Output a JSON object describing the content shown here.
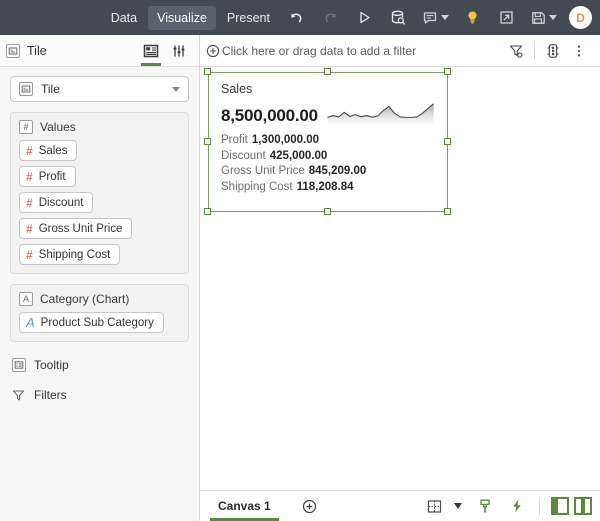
{
  "topbar": {
    "tabs": [
      {
        "label": "Data",
        "active": false
      },
      {
        "label": "Visualize",
        "active": true
      },
      {
        "label": "Present",
        "active": false
      }
    ],
    "icons": [
      {
        "name": "undo-icon",
        "label": "Undo"
      },
      {
        "name": "redo-icon",
        "label": "Redo"
      },
      {
        "name": "run-icon",
        "label": "Run"
      },
      {
        "name": "data-source-icon",
        "label": "Data source"
      },
      {
        "name": "comment-icon",
        "label": "Comments"
      },
      {
        "name": "insights-icon",
        "label": "Insights"
      },
      {
        "name": "expand-icon",
        "label": "Open in new window"
      },
      {
        "name": "save-icon",
        "label": "Save"
      }
    ],
    "avatar_initial": "D",
    "colors": {
      "background": "#434a54",
      "active_tab": "#5a626e",
      "accent": "#e8963c"
    }
  },
  "sidebar": {
    "header": {
      "title": "Tile"
    },
    "header_tabs": [
      {
        "name": "layout-tab",
        "active": true
      },
      {
        "name": "settings-tab",
        "active": false
      }
    ],
    "tile_select": {
      "value": "Tile"
    },
    "shelves": [
      {
        "title": "Values",
        "icon": "hash-box-icon",
        "fields": [
          {
            "label": "Sales",
            "glyph": "#",
            "type": "number"
          },
          {
            "label": "Profit",
            "glyph": "#",
            "type": "number"
          },
          {
            "label": "Discount",
            "glyph": "#",
            "type": "number"
          },
          {
            "label": "Gross Unit Price",
            "glyph": "#",
            "type": "number"
          },
          {
            "label": "Shipping Cost",
            "glyph": "#",
            "type": "number"
          }
        ]
      },
      {
        "title": "Category (Chart)",
        "icon": "letter-box-icon",
        "fields": [
          {
            "label": "Product Sub Category",
            "glyph": "A",
            "type": "text"
          }
        ]
      }
    ],
    "items": [
      {
        "label": "Tooltip",
        "icon": "tooltip-icon"
      },
      {
        "label": "Filters",
        "icon": "funnel-icon"
      }
    ]
  },
  "filterbar": {
    "placeholder": "Click here or drag data to add a filter",
    "add_icon": "plus-circle-icon",
    "actions": [
      {
        "name": "clear-filters-icon"
      },
      {
        "name": "traffic-light-icon"
      },
      {
        "name": "more-options-icon"
      }
    ]
  },
  "tile": {
    "title": "Sales",
    "value": "8,500,000.00",
    "kpis": [
      {
        "label": "Profit",
        "value": "1,300,000.00"
      },
      {
        "label": "Discount",
        "value": "425,000.00"
      },
      {
        "label": "Gross Unit Price",
        "value": "845,209.00"
      },
      {
        "label": "Shipping Cost",
        "value": "118,208.84"
      }
    ],
    "selection_color": "#5c8a3c"
  },
  "chart_data": {
    "type": "area",
    "title": "Sales sparkline",
    "xlabel": "",
    "ylabel": "",
    "x": [
      0,
      1,
      2,
      3,
      4,
      5,
      6,
      7,
      8,
      9,
      10,
      11,
      12,
      13,
      14,
      15,
      16,
      17,
      18,
      19
    ],
    "values": [
      22,
      30,
      24,
      44,
      26,
      34,
      25,
      30,
      23,
      28,
      52,
      70,
      40,
      24,
      22,
      22,
      24,
      40,
      62,
      82
    ],
    "ylim": [
      0,
      100
    ],
    "grid": false,
    "legend": false,
    "fill": "#9a9a9a",
    "line": "#4a4a4a"
  },
  "statusbar": {
    "canvas_tab": "Canvas 1",
    "add_canvas_icon": "plus-circle-icon",
    "actions": [
      {
        "name": "grid-layout-icon"
      },
      {
        "name": "paint-brush-icon"
      },
      {
        "name": "lightning-icon"
      },
      {
        "name": "left-panel-toggle-icon"
      },
      {
        "name": "center-panel-toggle-icon"
      }
    ],
    "accent_color": "#5c8a3c"
  }
}
